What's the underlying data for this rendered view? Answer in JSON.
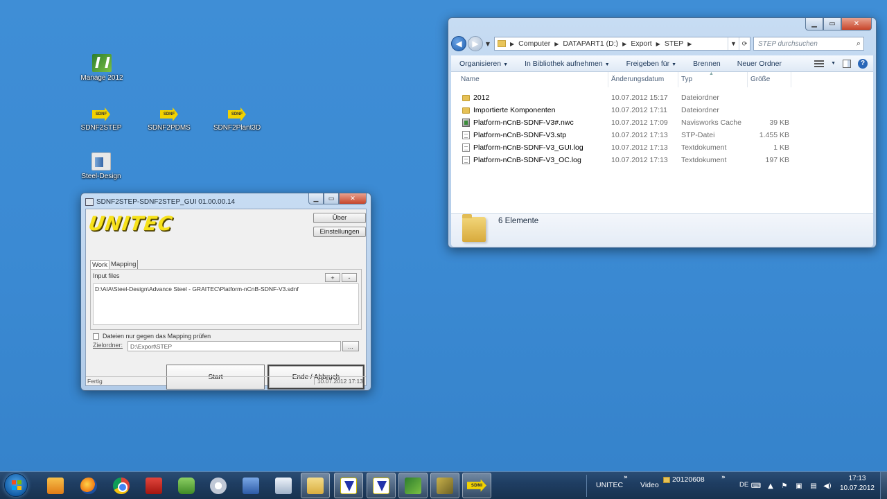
{
  "desktop": {
    "icons": [
      {
        "label": "Manage 2012",
        "icon": "navisworks-manage-icon"
      },
      {
        "label": "SDNF2STEP",
        "icon": "sdnf-arrow-icon"
      },
      {
        "label": "SDNF2PDMS",
        "icon": "sdnf-arrow-icon"
      },
      {
        "label": "SDNF2Plant3D",
        "icon": "sdnf-arrow-icon"
      },
      {
        "label": "Steel-Design",
        "icon": "steel-design-icon"
      }
    ],
    "sdnf_icon_text": "SDNF"
  },
  "explorer": {
    "breadcrumb": [
      "Computer",
      "DATAPART1 (D:)",
      "Export",
      "STEP"
    ],
    "search_placeholder": "STEP durchsuchen",
    "toolbar": {
      "organize": "Organisieren",
      "library": "In Bibliothek aufnehmen",
      "share": "Freigeben für",
      "burn": "Brennen",
      "new_folder": "Neuer Ordner"
    },
    "columns": {
      "name": "Name",
      "date": "Änderungsdatum",
      "type": "Typ",
      "size": "Größe"
    },
    "files": [
      {
        "name": "2012",
        "date": "10.07.2012 15:17",
        "type": "Dateiordner",
        "size": "",
        "icon": "folder-icon"
      },
      {
        "name": "Importierte Komponenten",
        "date": "10.07.2012 17:11",
        "type": "Dateiordner",
        "size": "",
        "icon": "folder-icon"
      },
      {
        "name": "Platform-nCnB-SDNF-V3#.nwc",
        "date": "10.07.2012 17:09",
        "type": "Navisworks Cache",
        "size": "39 KB",
        "icon": "navisworks-file-icon"
      },
      {
        "name": "Platform-nCnB-SDNF-V3.stp",
        "date": "10.07.2012 17:13",
        "type": "STP-Datei",
        "size": "1.455 KB",
        "icon": "file-icon"
      },
      {
        "name": "Platform-nCnB-SDNF-V3_GUI.log",
        "date": "10.07.2012 17:13",
        "type": "Textdokument",
        "size": "1 KB",
        "icon": "text-file-icon"
      },
      {
        "name": "Platform-nCnB-SDNF-V3_OC.log",
        "date": "10.07.2012 17:13",
        "type": "Textdokument",
        "size": "197 KB",
        "icon": "text-file-icon"
      }
    ],
    "item_count": "6 Elemente"
  },
  "sdnf_dialog": {
    "title": "SDNF2STEP-SDNF2STEP_GUI 01.00.00.14",
    "logo": "UNITEC",
    "about_button": "Über",
    "settings_button": "Einstellungen",
    "tabs": [
      "Work",
      "Mapping"
    ],
    "input_files_label": "Input files",
    "add_button": "+",
    "remove_button": "-",
    "input_files": [
      "D:\\AIA\\Steel-Design\\Advance Steel - GRAITEC\\Platform-nCnB-SDNF-V3.sdnf"
    ],
    "mapping_check_label": "Dateien nur gegen das Mapping prüfen",
    "target_label": "Zielordner:",
    "target_value": "D:\\Export\\STEP",
    "browse_button": "...",
    "start_button": "Start",
    "cancel_button": "Ende / Abbruch",
    "status": "Fertig",
    "status_time": "10.07.2012 17:13"
  },
  "taskbar": {
    "apps": [
      "media-player-icon",
      "firefox-icon",
      "chrome-icon",
      "acrobat-icon",
      "evernote-icon",
      "satellite-icon",
      "network-icon",
      "calculator-icon",
      "explorer-folder-icon",
      "vm-icon",
      "vm-icon",
      "navisworks-icon",
      "advance-steel-icon",
      "sdnf-icon"
    ],
    "sdnf_text": "SDNI",
    "toolbar_labels": [
      "UNITEC",
      "Video",
      "20120608"
    ],
    "chevron": "»",
    "language": "DE",
    "clock_time": "17:13",
    "clock_date": "10.07.2012"
  },
  "colors": {
    "desktop_bg": "#3b8ad3",
    "logo_yellow": "#f7e21b",
    "taskbar": "#1f3e63"
  }
}
